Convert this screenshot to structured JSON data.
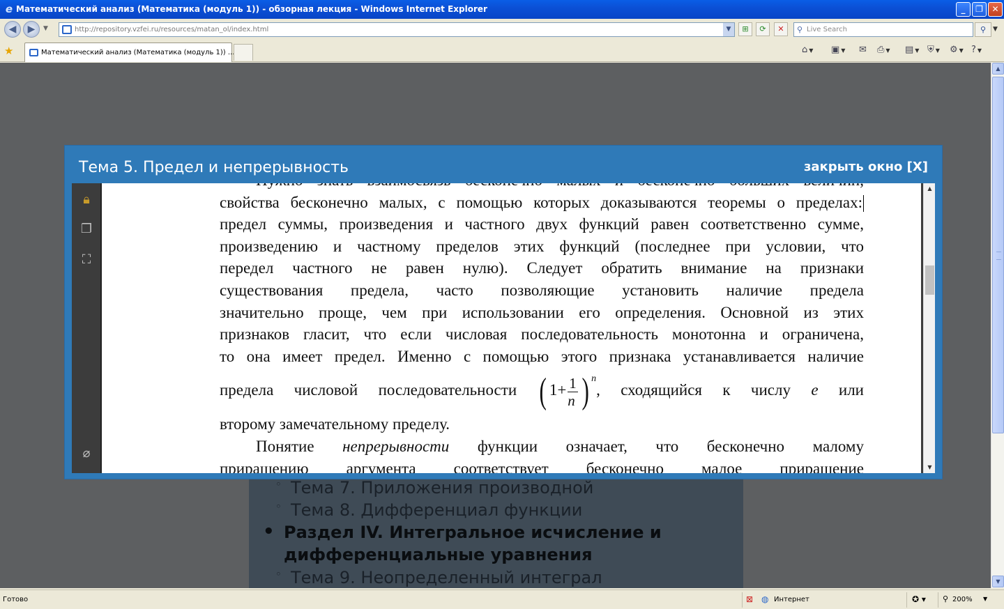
{
  "window": {
    "title": "Математический анализ (Математика (модуль 1)) - обзорная лекция - Windows Internet Explorer",
    "controls": [
      "minimize",
      "maximize",
      "close"
    ]
  },
  "address_bar": {
    "url": "http://repository.vzfei.ru/resources/matan_ol/index.html",
    "search_placeholder": "Live Search"
  },
  "tabs": [
    {
      "label": "Математический анализ (Математика (модуль 1)) ..."
    }
  ],
  "modal": {
    "title": "Тема 5. Предел и непрерывность",
    "close_label": "закрыть окно [X]",
    "pdf_text": {
      "line0": "Нужно знать взаимосвязь бесконечно малых и бесконечно больших величин,",
      "line1": "свойства бесконечно малых, с помощью которых доказываются теоремы о пределах:",
      "line2": "предел суммы, произведения и частного двух функций равен соответственно сумме,",
      "line3": "произведению и частному пределов этих функций (последнее при условии, что",
      "line4": "передел частного не равен нулю). Следует обратить внимание на признаки",
      "line5": "существования предела, часто позволяющие установить наличие предела",
      "line6": "значительно проще, чем при использовании его определения. Основной из этих",
      "line7": "признаков гласит, что если числовая последовательность монотонна и ограничена,",
      "line8": "то она имеет предел. Именно с помощью этого признака устанавливается наличие",
      "line9_start": "предела числовой последовательности",
      "formula_one": "1",
      "formula_plus": "+",
      "formula_num": "1",
      "formula_den": "n",
      "formula_exp": "n",
      "line9_end_a": ", сходящийся к числу",
      "line9_e": "e",
      "line9_end_b": "или",
      "line10": "второму замечательному пределу.",
      "line11_a": "Понятие",
      "line11_em": "непрерывности",
      "line11_b": "функции означает, что бесконечно малому",
      "line12": "приращению аргумента соответствует бесконечно малое приращение"
    }
  },
  "background_list": {
    "item1": "Тема 7. Приложения производной",
    "item2": "Тема 8. Дифференциал функции",
    "section_line1": "Раздел IV. Интегральное исчисление и",
    "section_line2": "дифференциальные уравнения",
    "item3": "Тема 9. Неопределенный интеграл"
  },
  "status_bar": {
    "status": "Готово",
    "zone": "Интернет",
    "zoom": "200%"
  },
  "colors": {
    "modal_blue": "#2f7ab8",
    "overlay": "#5d5f61"
  }
}
